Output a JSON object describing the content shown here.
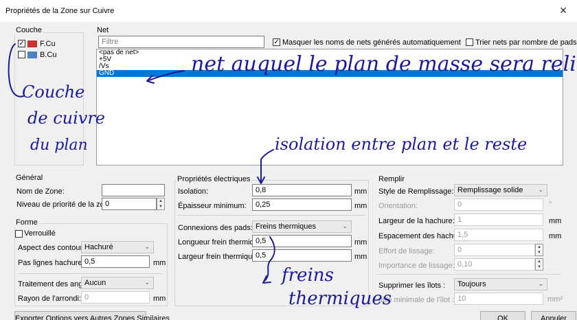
{
  "window": {
    "title": "Propriétés de la Zone sur Cuivre",
    "close_glyph": "✕"
  },
  "layers": {
    "title": "Couche",
    "items": [
      {
        "label": "F.Cu",
        "checked": true,
        "color": "#c83232"
      },
      {
        "label": "B.Cu",
        "checked": false,
        "color": "#4d7fc4"
      }
    ]
  },
  "net": {
    "title": "Net",
    "filter_placeholder": "Filtre",
    "hide_auto_label": "Masquer les noms de nets générés automatiquement",
    "hide_auto_checked": true,
    "sort_label": "Trier nets par nombre de pads",
    "sort_checked": false,
    "items": [
      {
        "label": "<pas de net>",
        "selected": false
      },
      {
        "label": "+5V",
        "selected": false
      },
      {
        "label": "/Vs",
        "selected": false
      },
      {
        "label": "GND",
        "selected": true
      }
    ]
  },
  "general": {
    "title": "Général",
    "zone_name_label": "Nom de Zone:",
    "zone_name_value": "",
    "priority_label": "Niveau de priorité de la zone:",
    "priority_value": "0"
  },
  "shape": {
    "title": "Forme",
    "locked_label": "Verrouillé",
    "locked_checked": false,
    "outline_label": "Aspect des contours:",
    "outline_value": "Hachuré",
    "hatch_pitch_label": "Pas lignes hachure:",
    "hatch_pitch_value": "0,5",
    "hatch_pitch_unit": "mm",
    "corner_label": "Traitement des angles:",
    "corner_value": "Aucun",
    "radius_label": "Rayon de l'arrondi:",
    "radius_value": "0",
    "radius_unit": "mm"
  },
  "electrical": {
    "title": "Propriétés électriques",
    "clearance_label": "Isolation:",
    "clearance_value": "0,8",
    "clearance_unit": "mm",
    "min_width_label": "Épaisseur minimum:",
    "min_width_value": "0,25",
    "min_width_unit": "mm",
    "pad_conn_label": "Connexions des pads:",
    "pad_conn_value": "Freins thermiques",
    "thermal_gap_label": "Longueur frein thermique:",
    "thermal_gap_value": "0,5",
    "thermal_gap_unit": "mm",
    "thermal_width_label": "Largeur frein thermique:",
    "thermal_width_value": "0,5",
    "thermal_width_unit": "mm"
  },
  "fill": {
    "title": "Remplir",
    "style_label": "Style de Remplissage:",
    "style_value": "Remplissage solide",
    "orientation_label": "Orientation:",
    "orientation_value": "0",
    "orientation_unit": "°",
    "hatch_width_label": "Largeur de la hachure:",
    "hatch_width_value": "1",
    "hatch_width_unit": "mm",
    "hatch_gap_label": "Espacement des hachures:",
    "hatch_gap_value": "1,5",
    "hatch_gap_unit": "mm",
    "smoothing_label": "Effort de lissage:",
    "smoothing_value": "0",
    "smoothing_amount_label": "Importance de lissage:",
    "smoothing_amount_value": "0,10",
    "remove_islands_label": "Supprimer les îlots :",
    "remove_islands_value": "Toujours",
    "min_island_label": "aille minimale de l'îlot :",
    "min_island_value": "10",
    "min_island_unit": "mm²"
  },
  "buttons": {
    "export": "Exporter Options vers Autres Zones Similaires",
    "ok": "OK",
    "cancel": "Annuler"
  },
  "annotations": {
    "net_note": "net auquel le plan de masse sera relié",
    "layer_note_1": "Couche",
    "layer_note_2": "de cuivre",
    "layer_note_3": "du plan",
    "isolation_note": "isolation entre plan et le reste",
    "thermal_note_1": "freins",
    "thermal_note_2": "thermiques",
    "ink_color": "#1a1a9a"
  }
}
